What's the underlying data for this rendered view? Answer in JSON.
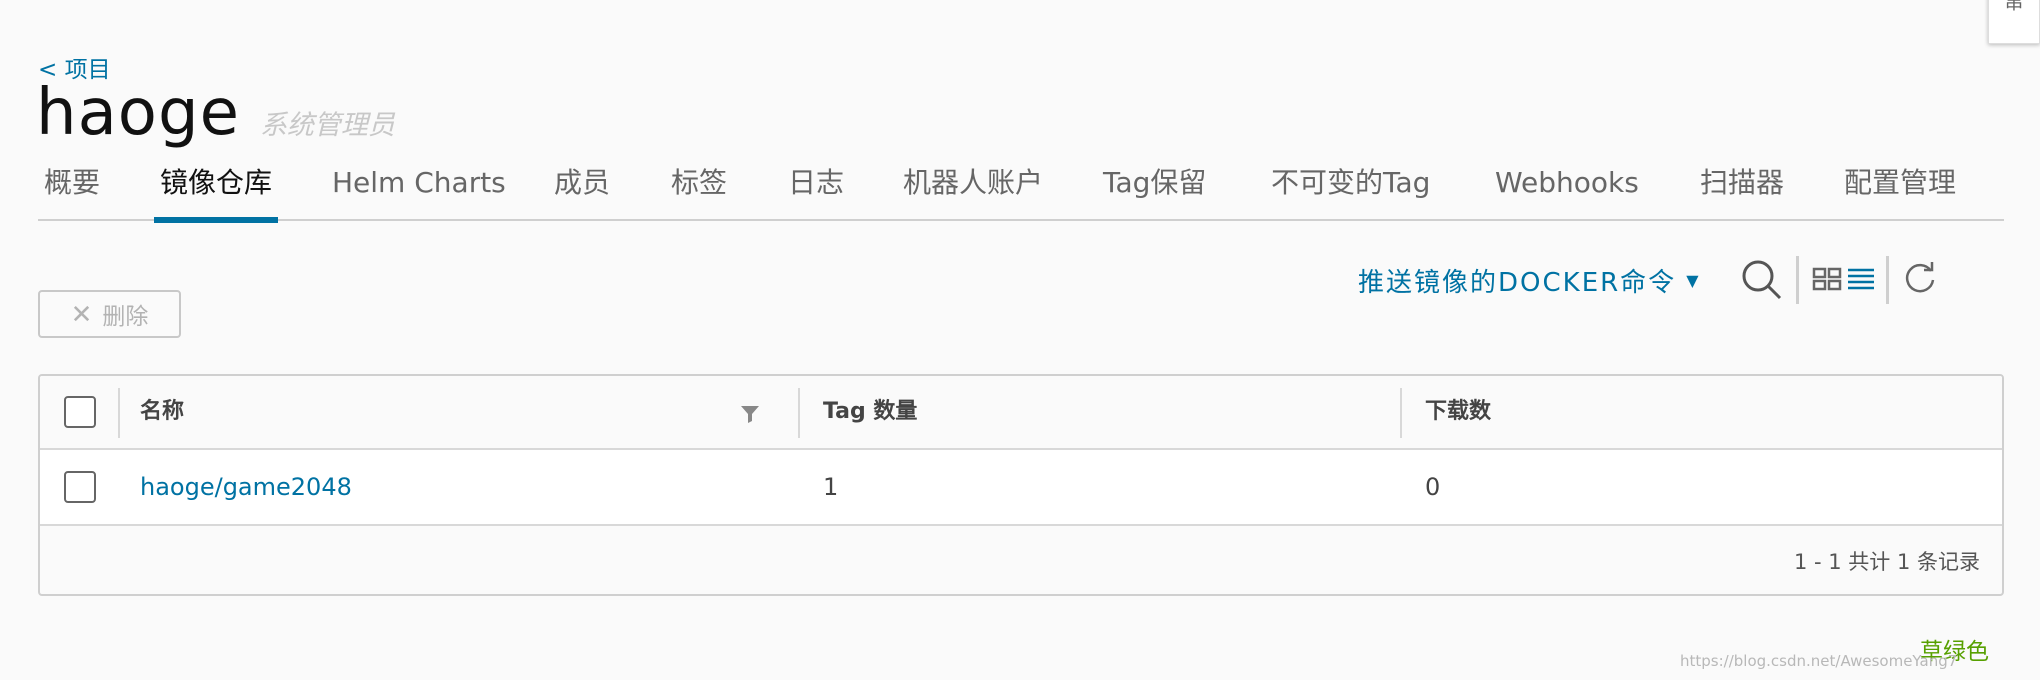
{
  "breadcrumb": {
    "back_label": "< 项目"
  },
  "project": {
    "name": "haoge",
    "role": "系统管理员"
  },
  "tabs": [
    {
      "label": "概要"
    },
    {
      "label": "镜像仓库",
      "active": true
    },
    {
      "label": "Helm Charts"
    },
    {
      "label": "成员"
    },
    {
      "label": "标签"
    },
    {
      "label": "日志"
    },
    {
      "label": "机器人账户"
    },
    {
      "label": "Tag保留"
    },
    {
      "label": "不可变的Tag"
    },
    {
      "label": "Webhooks"
    },
    {
      "label": "扫描器"
    },
    {
      "label": "配置管理"
    }
  ],
  "toolbar": {
    "delete_label": "删除",
    "push_command_label": "推送镜像的DOCKER命令",
    "icons": [
      "search-icon",
      "card-view-icon",
      "list-view-icon",
      "refresh-icon"
    ]
  },
  "table": {
    "headers": {
      "name": "名称",
      "tag_count": "Tag 数量",
      "downloads": "下载数"
    },
    "rows": [
      {
        "name": "haoge/game2048",
        "tag_count": "1",
        "downloads": "0"
      }
    ],
    "footer": "1 - 1 共计 1 条记录"
  },
  "overlay": {
    "watermark_label": "草绿色",
    "url_watermark": "https://blog.csdn.net/AwesomeYang7",
    "corner_char": "串"
  },
  "colors": {
    "accent": "#0072a3",
    "watermark": "#57a000",
    "border": "#cfcfcf"
  }
}
